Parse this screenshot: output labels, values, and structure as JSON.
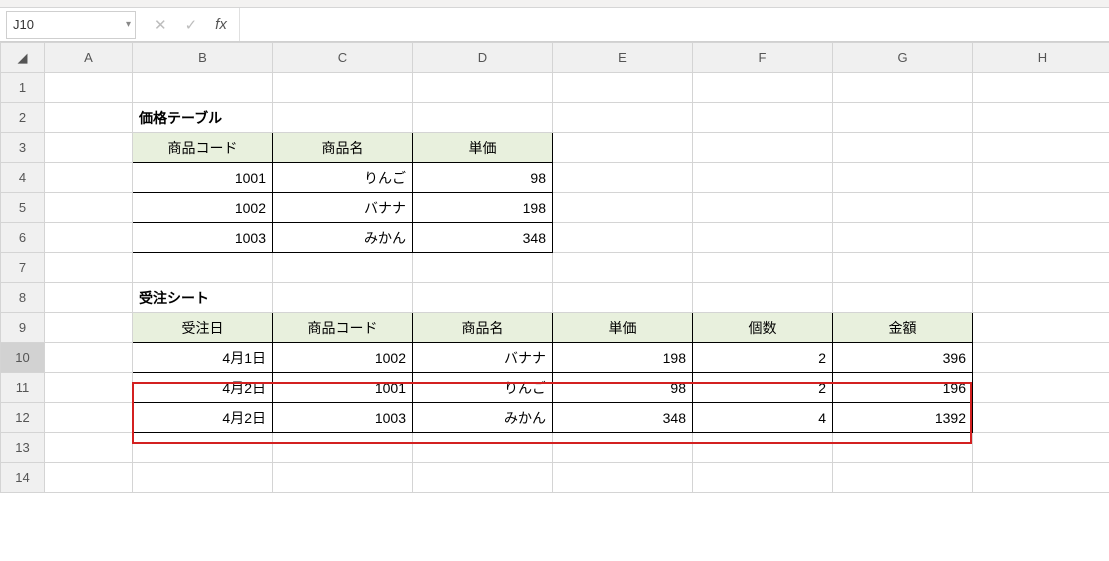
{
  "nameBox": "J10",
  "formula": "",
  "columns": [
    "A",
    "B",
    "C",
    "D",
    "E",
    "F",
    "G",
    "H"
  ],
  "rows": [
    "1",
    "2",
    "3",
    "4",
    "5",
    "6",
    "7",
    "8",
    "9",
    "10",
    "11",
    "12",
    "13",
    "14"
  ],
  "priceTable": {
    "title": "価格テーブル",
    "headers": {
      "code": "商品コード",
      "name": "商品名",
      "price": "単価"
    },
    "rows": [
      {
        "code": "1001",
        "name": "りんご",
        "price": "98"
      },
      {
        "code": "1002",
        "name": "バナナ",
        "price": "198"
      },
      {
        "code": "1003",
        "name": "みかん",
        "price": "348"
      }
    ]
  },
  "orderSheet": {
    "title": "受注シート",
    "headers": {
      "date": "受注日",
      "code": "商品コード",
      "name": "商品名",
      "price": "単価",
      "qty": "個数",
      "amount": "金額"
    },
    "rows": [
      {
        "date": "4月1日",
        "code": "1002",
        "name": "バナナ",
        "price": "198",
        "qty": "2",
        "amount": "396"
      },
      {
        "date": "4月2日",
        "code": "1001",
        "name": "りんご",
        "price": "98",
        "qty": "2",
        "amount": "196"
      },
      {
        "date": "4月2日",
        "code": "1003",
        "name": "みかん",
        "price": "348",
        "qty": "4",
        "amount": "1392"
      }
    ]
  }
}
